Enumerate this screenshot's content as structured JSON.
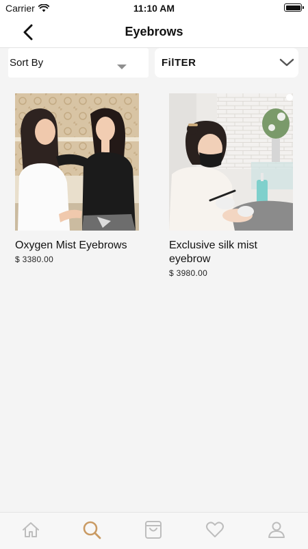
{
  "status_bar": {
    "carrier": "Carrier",
    "time": "11:10 AM"
  },
  "nav": {
    "title": "Eyebrows",
    "back_icon": "chevron-left-icon"
  },
  "controls": {
    "sort_label": "Sort By",
    "filter_label": "FilTER"
  },
  "products": [
    {
      "name": "Oxygen Mist Eyebrows",
      "price": "$ 3380.00",
      "image": "two-women-consultation-photo"
    },
    {
      "name": "Exclusive silk mist eyebrow",
      "price": "$ 3980.00",
      "image": "brow-technician-treatment-photo"
    }
  ],
  "tab_bar": {
    "items": [
      "home-icon",
      "search-icon",
      "bag-icon",
      "heart-icon",
      "profile-icon"
    ],
    "active": "search-icon",
    "colors": {
      "active": "#c99a63",
      "inactive": "#bdbdbd"
    }
  }
}
